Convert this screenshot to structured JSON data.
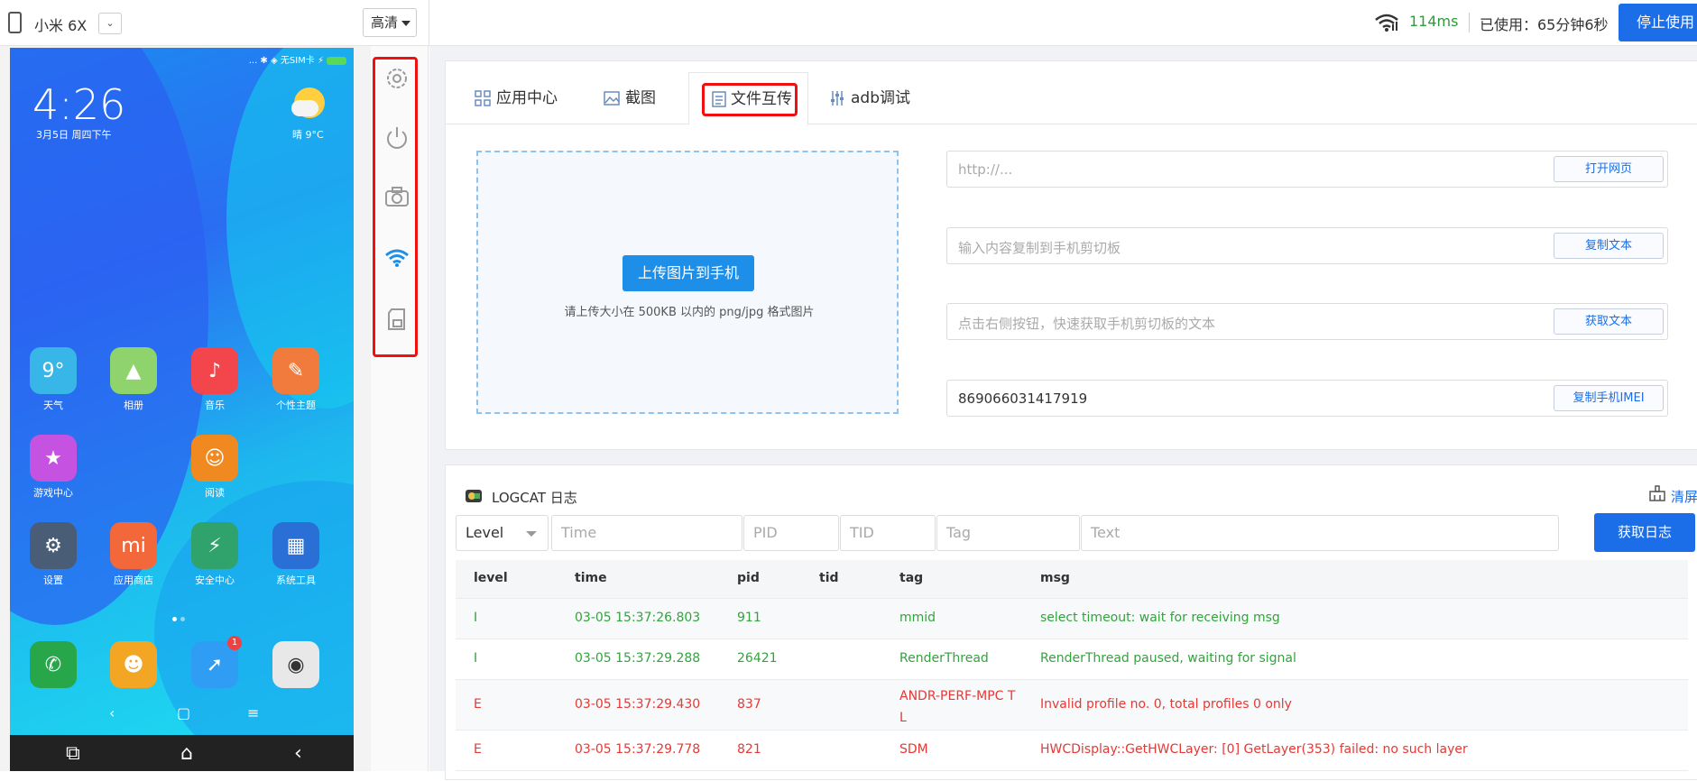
{
  "topbar": {
    "device_name": "小米 6X",
    "device_select_glyph": "⌄",
    "quality": "高清",
    "latency": "114ms",
    "usage": "已使用：65分钟6秒",
    "stop_button": "停止使用"
  },
  "phone": {
    "status_text": "... ✱ ◈ 无SIM卡 ⚡",
    "clock": "4:26",
    "date": "3月5日 周四下午",
    "weather": "晴 9°C",
    "apps": [
      {
        "label": "天气",
        "glyph": "9°",
        "color": "#39b6e8"
      },
      {
        "label": "相册",
        "glyph": "▲",
        "color": "#8ed36b"
      },
      {
        "label": "音乐",
        "glyph": "♪",
        "color": "#f2464c"
      },
      {
        "label": "个性主题",
        "glyph": "✎",
        "color": "#f07b3c"
      },
      {
        "label": "游戏中心",
        "glyph": "★",
        "color": "#c552e0"
      },
      {
        "label": "阅读",
        "glyph": "☺",
        "color": "#f08a20"
      },
      {
        "label": "设置",
        "glyph": "⚙",
        "color": "#4a5d76"
      },
      {
        "label": "应用商店",
        "glyph": "mi",
        "color": "#f2683a"
      },
      {
        "label": "安全中心",
        "glyph": "⚡",
        "color": "#2fa36b"
      },
      {
        "label": "系统工具",
        "glyph": "▦",
        "color": "#2a6fd6"
      }
    ],
    "dock": [
      {
        "glyph": "✆",
        "color": "#27a64a"
      },
      {
        "glyph": "☻",
        "color": "#f3a623"
      },
      {
        "glyph": "➚",
        "color": "#2f9df3",
        "badge": "1"
      },
      {
        "glyph": "◉",
        "color": "#e8e8e8"
      }
    ],
    "nav_soft": [
      "‹",
      "▢",
      "≡"
    ],
    "nav_hard": [
      "⧉",
      "⌂",
      "‹"
    ]
  },
  "tools": [
    "settings-icon",
    "power-icon",
    "camera-icon",
    "wifi-icon",
    "sd-card-icon"
  ],
  "tabs": [
    {
      "label": "应用中心",
      "icon": "grid-icon"
    },
    {
      "label": "截图",
      "icon": "image-icon"
    },
    {
      "label": "文件互传",
      "icon": "file-icon"
    },
    {
      "label": "adb调试",
      "icon": "sliders-icon"
    }
  ],
  "upload": {
    "button": "上传图片到手机",
    "hint": "请上传大小在 500KB 以内的 png/jpg 格式图片"
  },
  "fields": [
    {
      "placeholder": "http://...",
      "value": "",
      "button": "打开网页"
    },
    {
      "placeholder": "输入内容复制到手机剪切板",
      "value": "",
      "button": "复制文本"
    },
    {
      "placeholder": "点击右侧按钮，快速获取手机剪切板的文本",
      "value": "",
      "button": "获取文本"
    },
    {
      "placeholder": "",
      "value": "869066031417919",
      "button": "复制手机IMEI"
    }
  ],
  "logcat": {
    "title": "LOGCAT 日志",
    "clear": "清屏",
    "filters": {
      "level": "Level",
      "time": "Time",
      "pid": "PID",
      "tid": "TID",
      "tag": "Tag",
      "text": "Text"
    },
    "fetch_button": "获取日志",
    "columns": [
      "level",
      "time",
      "pid",
      "tid",
      "tag",
      "msg"
    ],
    "rows": [
      {
        "level": "I",
        "time": "03-05 15:37:26.803",
        "pid": "911",
        "tid": "",
        "tag": "mmid",
        "msg": "select timeout: wait for receiving msg"
      },
      {
        "level": "I",
        "time": "03-05 15:37:29.288",
        "pid": "26421",
        "tid": "",
        "tag": "RenderThread",
        "msg": "RenderThread paused, waiting for signal"
      },
      {
        "level": "E",
        "time": "03-05 15:37:29.430",
        "pid": "837",
        "tid": "",
        "tag": "ANDR-PERF-MPC TL",
        "msg": "Invalid profile no. 0, total profiles 0 only"
      },
      {
        "level": "E",
        "time": "03-05 15:37:29.778",
        "pid": "821",
        "tid": "",
        "tag": "SDM",
        "msg": "HWCDisplay::GetHWCLayer: [0] GetLayer(353) failed: no such layer"
      }
    ]
  }
}
